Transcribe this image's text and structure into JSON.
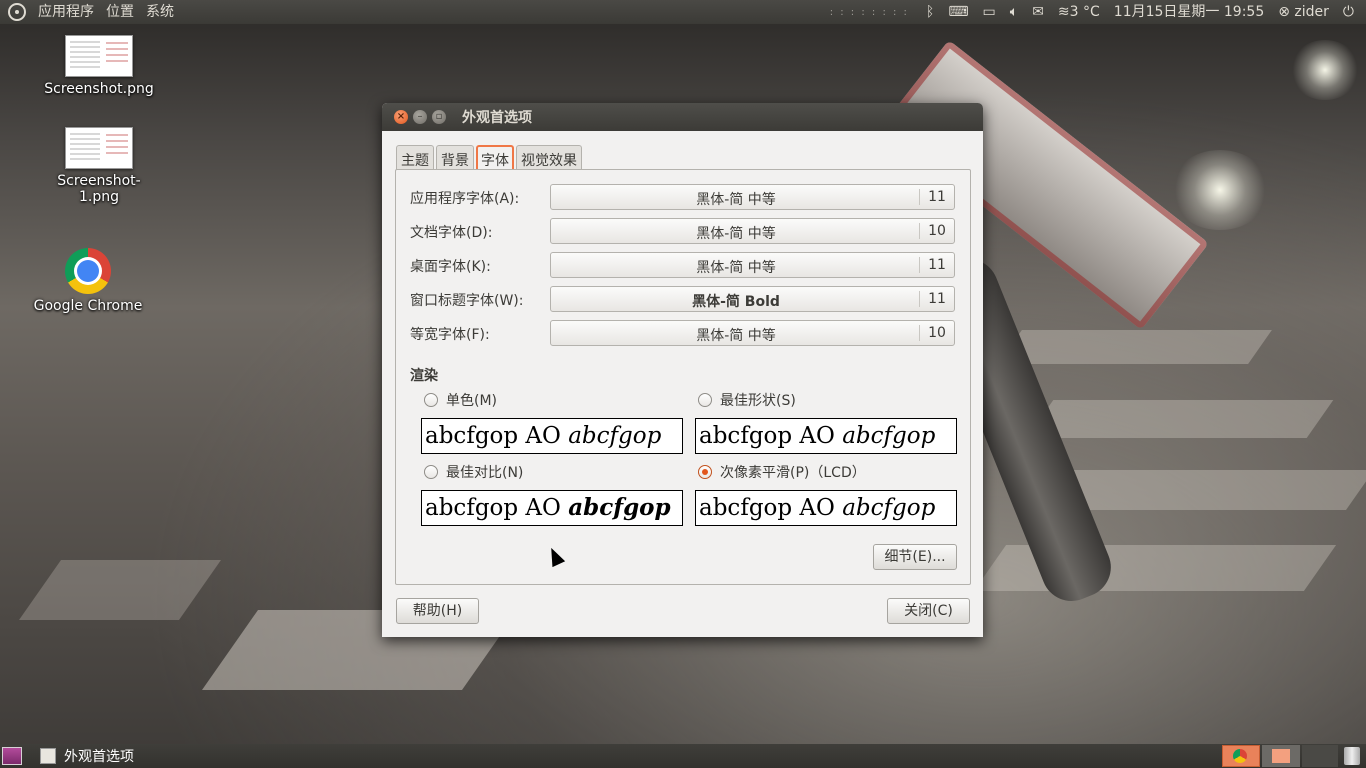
{
  "top_panel": {
    "menus": [
      "应用程序",
      "位置",
      "系统"
    ],
    "weather": "≋3 °C",
    "datetime": "11月15日星期一 19:55",
    "user": "zider"
  },
  "desktop_icons": [
    {
      "label": "Screenshot.png"
    },
    {
      "label": "Screenshot-1.png"
    },
    {
      "label": "Google Chrome"
    }
  ],
  "dialog": {
    "title": "外观首选项",
    "tabs": [
      "主题",
      "背景",
      "字体",
      "视觉效果"
    ],
    "active_tab": "字体",
    "font_rows": [
      {
        "label": "应用程序字体(A):",
        "font": "黑体-简 中等",
        "size": "11"
      },
      {
        "label": "文档字体(D):",
        "font": "黑体-简 中等",
        "size": "10"
      },
      {
        "label": "桌面字体(K):",
        "font": "黑体-简 中等",
        "size": "11"
      },
      {
        "label": "窗口标题字体(W):",
        "font": "黑体-简 Bold",
        "size": "11"
      },
      {
        "label": "等宽字体(F):",
        "font": "黑体-简 中等",
        "size": "10"
      }
    ],
    "rendering": {
      "title": "渲染",
      "options": [
        {
          "label": "单色(M)",
          "checked": false
        },
        {
          "label": "最佳形状(S)",
          "checked": false
        },
        {
          "label": "最佳对比(N)",
          "checked": false
        },
        {
          "label": "次像素平滑(P)（LCD）",
          "checked": true
        }
      ],
      "sample_plain": "abcfgop AO ",
      "sample_italic": "abcfgop"
    },
    "details_button": "细节(E)...",
    "help_button": "帮助(H)",
    "close_button": "关闭(C)"
  },
  "taskbar": {
    "window_title": "外观首选项"
  },
  "colors": {
    "accent": "#e2561c",
    "panel": "#3c3b37",
    "dialog_bg": "#f2f1f0"
  }
}
